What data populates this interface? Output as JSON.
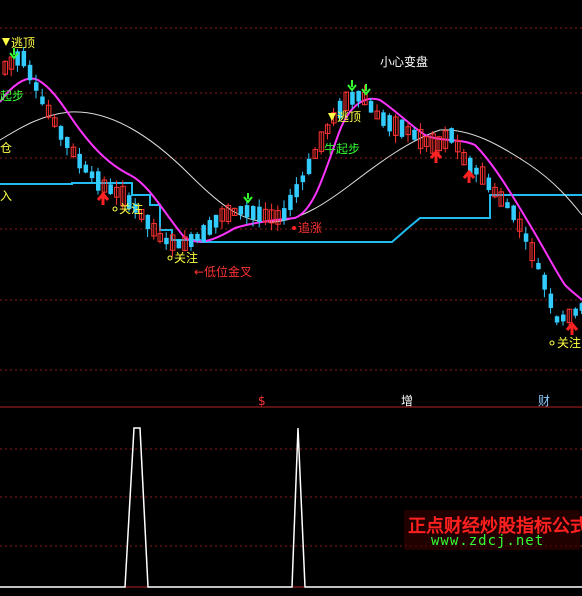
{
  "colors": {
    "background": "#000000",
    "candle_up": "#ff3333",
    "candle_down": "#33ccff",
    "ma_short": "#ff33ff",
    "ma_long": "#dddddd",
    "support_line": "#22bbee",
    "signal_yellow": "#ffff44",
    "signal_green": "#33ff33",
    "signal_red": "#ff2222",
    "grid": "#8b1a1a",
    "indicator": "#ffffff"
  },
  "upper_labels": {
    "escape_top_1": "逃顶",
    "rise_1": "起步",
    "warehouse": "仓",
    "enter": "入",
    "attention_1": "关注",
    "attention_2": "关注",
    "low_golden_cross": "←低位金叉",
    "chase_rise": "追涨",
    "careful_change": "小心变盘",
    "escape_top_2": "逃顶",
    "bull_start": "牛起步",
    "attention_3": "关注"
  },
  "lower_markers": {
    "marker_1": "$",
    "marker_2": "增",
    "marker_3": "财"
  },
  "watermark": {
    "title": "正点财经炒股指标公式",
    "url": "www.zdcj.net"
  },
  "chart_data": [
    {
      "type": "candlestick",
      "title": "",
      "description_series": [
        {
          "name": "",
          "kind": "line"
        },
        {
          "name": "",
          "kind": "line"
        },
        {
          "name": "",
          "kind": "step"
        }
      ]
    },
    {
      "type": "line",
      "title": "",
      "note": "indicator spikes",
      "spikes": 2
    }
  ]
}
